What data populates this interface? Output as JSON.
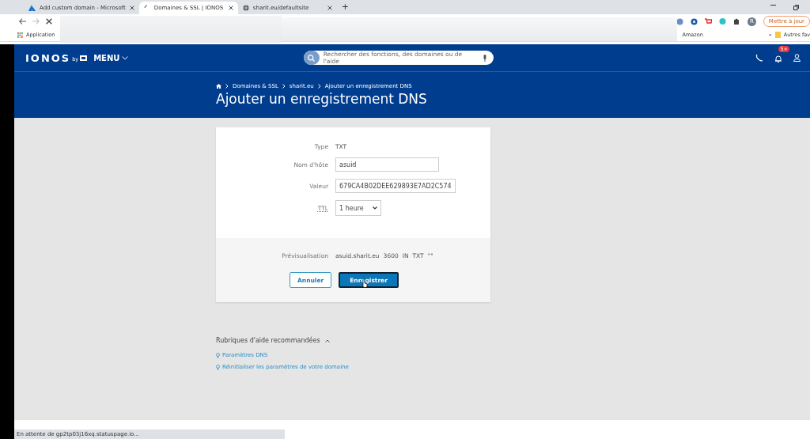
{
  "browser": {
    "tabs": [
      {
        "title": "Add custom domain - Microsoft",
        "selected": false,
        "kind": "azure"
      },
      {
        "title": "Domaines & SSL | IONOS",
        "selected": true,
        "kind": "loading"
      },
      {
        "title": "sharit.eu/defaultsite",
        "selected": false,
        "kind": "globe"
      }
    ],
    "new_tab": "+",
    "forward_disabled": true,
    "bookmarks": [
      {
        "label": "Application",
        "kind": "apps"
      },
      {
        "label": "Amazon",
        "kind": "plain"
      }
    ],
    "more": "»",
    "other_bookmarks": "Autres fav",
    "profile_initial": "R",
    "update_button": "Mettre à jour"
  },
  "header": {
    "logo": "IONOS",
    "logo_by": "by",
    "menu": "MENU",
    "search_placeholder": "Rechercher des fonctions, des domaines ou de l'aide",
    "badge": "5+"
  },
  "breadcrumb": [
    "Domaines & SSL",
    "sharit.eu",
    "Ajouter un enregistrement DNS"
  ],
  "title": "Ajouter un enregistrement DNS",
  "form": {
    "fields": [
      {
        "label": "Type",
        "kind": "text",
        "value": "TXT"
      },
      {
        "label": "Nom d'hôte",
        "kind": "input",
        "value": "asuid"
      },
      {
        "label": "Valeur",
        "kind": "input",
        "value": "679CA4B02DEE629893E7AD2C574"
      },
      {
        "label": "TTL",
        "kind": "select",
        "value": "1 heure"
      }
    ],
    "preview_label": "Prévisualisation",
    "preview": [
      "asuid.sharit.eu",
      "3600",
      "IN",
      "TXT",
      "\"\""
    ],
    "buttons": [
      {
        "label": "Annuler",
        "kind": "secondary"
      },
      {
        "label": "Enregistrer",
        "kind": "primary"
      }
    ]
  },
  "help": {
    "title": "Rubriques d'aide recommandées",
    "expanded": true,
    "links": [
      "Paramètres DNS",
      "Réinitialiser les paramètres de votre domaine"
    ]
  },
  "status_bar": "En attente de gp2tp03j16xq.statuspage.io..."
}
